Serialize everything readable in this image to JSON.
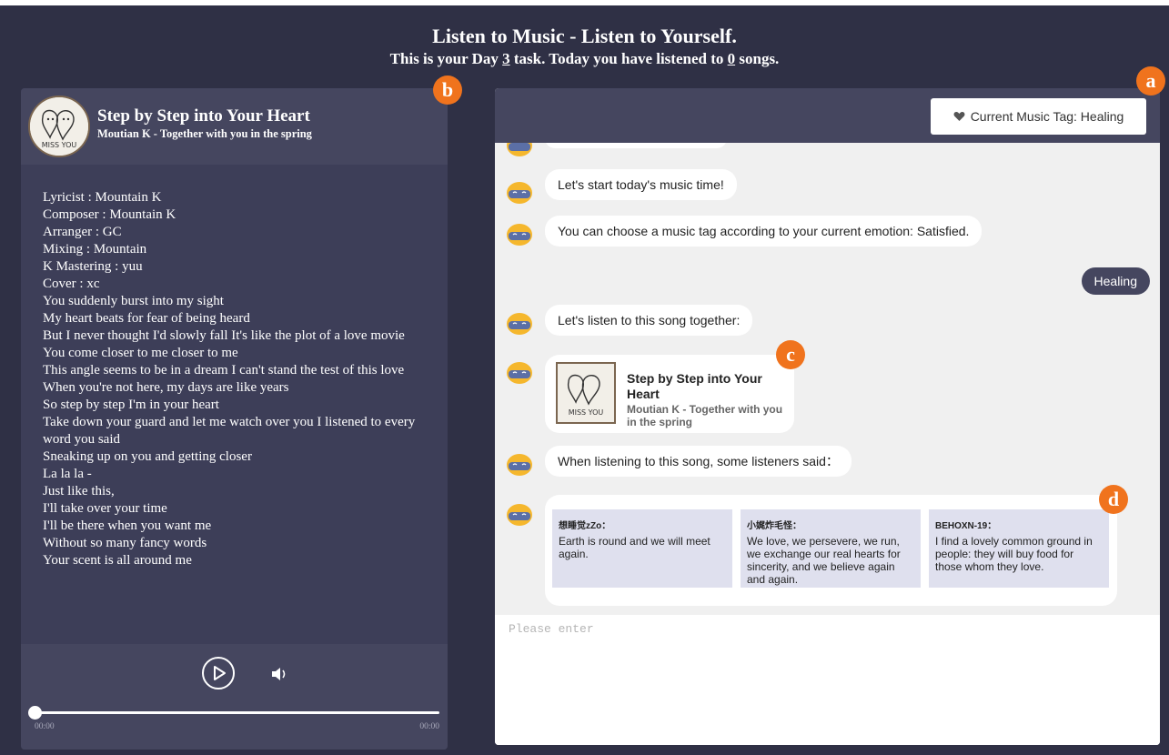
{
  "header": {
    "title": "Listen to Music - Listen to Yourself.",
    "subtitle_pre": "This is your Day ",
    "day": "3",
    "subtitle_mid": " task. Today you have listened to ",
    "count": "0",
    "subtitle_post": " songs."
  },
  "song": {
    "title": "Step by Step into Your Heart",
    "artist": "Moutian K - Together with you in the spring",
    "album_text": "MISS YOU"
  },
  "lyrics": [
    "Lyricist : Mountain K",
    "Composer : Mountain K",
    "Arranger : GC",
    "Mixing : Mountain",
    "K Mastering : yuu",
    "Cover : xc",
    "You suddenly burst into my sight",
    "My heart beats for fear of being heard",
    "But I never thought I'd slowly fall It's like the plot of a love movie",
    "You come closer to me closer to me",
    "This angle seems to be in a dream I can't stand the test of this love",
    "When you're not here, my days are like years",
    "So step by step I'm in your heart",
    "Take down your guard and let me watch over you I listened to every word you said",
    "Sneaking up on you and getting closer",
    "La la la -",
    "Just like this,",
    "I'll take over your time",
    "I'll be there when you want me",
    "Without so many fancy words",
    "Your scent is all around me"
  ],
  "player": {
    "time_start": "00:00",
    "time_end": "00:00",
    "progress": 0
  },
  "tag_button": {
    "label": "Current Music Tag: Healing"
  },
  "chat": {
    "messages": [
      "Let's start today's music time!",
      "You can choose a music tag according to your current emotion: Satisfied.",
      "Let's listen to this song together:",
      "When listening to this song, some listeners said："
    ],
    "user_reply": "Healing",
    "card": {
      "title": "Step by Step into Your Heart",
      "artist": "Moutian K - Together with you in the spring",
      "album_text": "MISS YOU"
    },
    "comments": [
      {
        "name": "想睡觉zZo：",
        "text": "Earth is round and we will meet again."
      },
      {
        "name": "小娓炸毛怪：",
        "text": "We love, we persevere, we run, we exchange our real hearts for sincerity, and we believe again and again."
      },
      {
        "name": "BEHOXN-19：",
        "text": "I find a lovely common ground in people: they will buy food for those whom they love."
      }
    ]
  },
  "input": {
    "placeholder": "Please enter"
  },
  "markers": [
    "a",
    "b",
    "c",
    "d"
  ],
  "colors": {
    "background": "#2f3045",
    "panel": "#3d3e58",
    "panel_header": "#45465f",
    "marker": "#f0731d",
    "chat_bg": "#f0f0f0",
    "comment_bg": "#dfe0ee"
  }
}
